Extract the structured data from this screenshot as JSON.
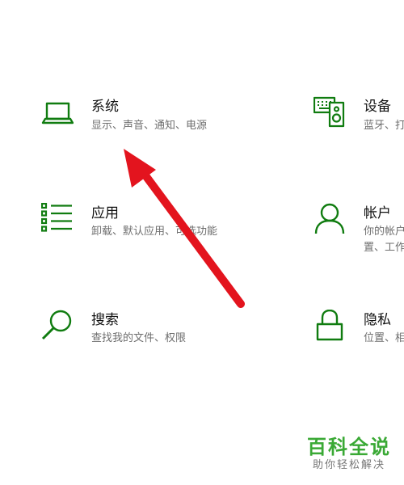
{
  "colors": {
    "icon_green": "#107c10",
    "arrow_red": "#e3141e",
    "watermark_green": "#3aa935"
  },
  "settings": {
    "system": {
      "icon": "laptop-icon",
      "title": "系统",
      "desc": "显示、声音、通知、电源"
    },
    "devices": {
      "icon": "keyboard-speaker-icon",
      "title": "设备",
      "desc": "蓝牙、打"
    },
    "apps": {
      "icon": "list-icon",
      "title": "应用",
      "desc": "卸载、默认应用、可选功能"
    },
    "accounts": {
      "icon": "person-icon",
      "title": "帐户",
      "desc": "你的帐户",
      "desc2": "置、工作"
    },
    "search": {
      "icon": "magnifier-icon",
      "title": "搜索",
      "desc": "查找我的文件、权限"
    },
    "privacy": {
      "icon": "lock-icon",
      "title": "隐私",
      "desc": "位置、相"
    }
  },
  "annotation": {
    "icon": "red-arrow"
  },
  "watermark": {
    "main": "百科全说",
    "sub": "助你轻松解决"
  }
}
